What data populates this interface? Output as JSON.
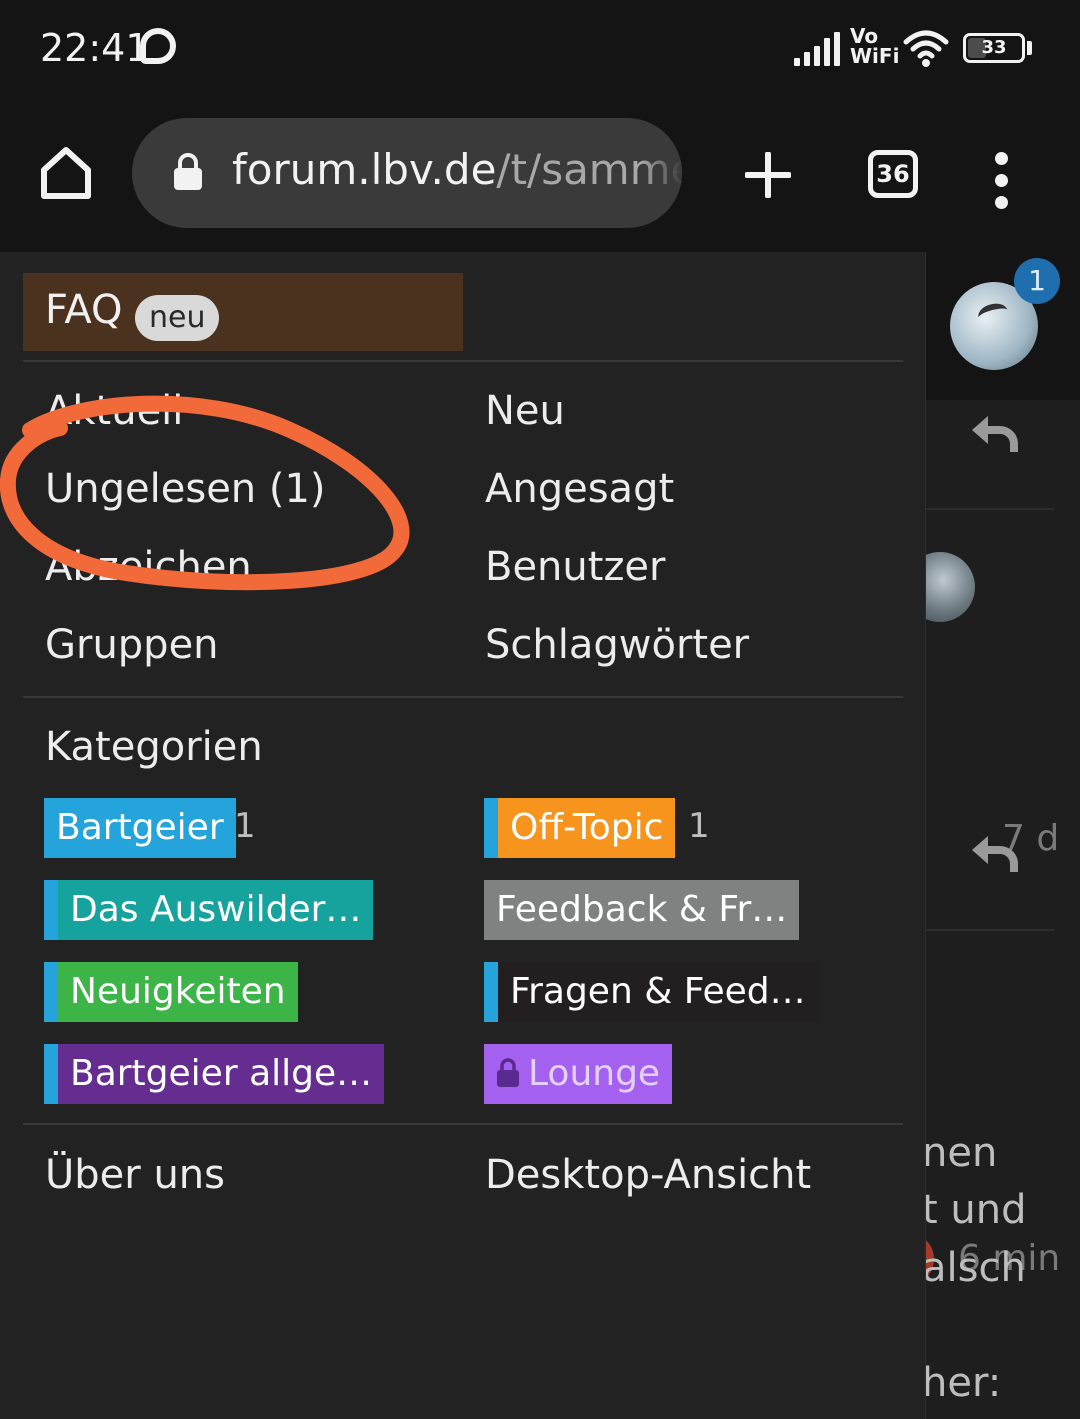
{
  "status_bar": {
    "time": "22:41",
    "network_label_line1": "Vo",
    "network_label_line2": "WiFi",
    "battery": "33"
  },
  "browser": {
    "url_domain": "forum.lbv.de",
    "url_path": "/t/samme",
    "tab_count": "36"
  },
  "menu": {
    "faq_label": "FAQ",
    "faq_badge": "neu",
    "links_left": [
      "Aktuell",
      "Ungelesen (1)",
      "Abzeichen",
      "Gruppen"
    ],
    "links_right": [
      "Neu",
      "Angesagt",
      "Benutzer",
      "Schlagwörter"
    ],
    "categories_title": "Kategorien",
    "categories_left": [
      {
        "label": "Bartgeier",
        "count": "1",
        "color": "#25a4dc",
        "stripe": "#25a4dc"
      },
      {
        "label": "Das Auswilder…",
        "count": "",
        "color": "#16a39e",
        "stripe": "#25a4dc"
      },
      {
        "label": "Neuigkeiten",
        "count": "",
        "color": "#3cb448",
        "stripe": "#25a4dc"
      },
      {
        "label": "Bartgeier allge…",
        "count": "",
        "color": "#652d90",
        "stripe": "#25a4dc"
      }
    ],
    "categories_right": [
      {
        "label": "Off-Topic",
        "count": "1",
        "color": "#f7941d",
        "stripe": "#25a4dc"
      },
      {
        "label": "Feedback & Fr…",
        "count": "",
        "color": "#808281",
        "stripe": ""
      },
      {
        "label": "Fragen & Feed…",
        "count": "",
        "color": "#231f20",
        "stripe": "#25a4dc"
      },
      {
        "label": "Lounge",
        "count": "",
        "color": "#a461ef",
        "stripe": ""
      }
    ],
    "footer_left": "Über uns",
    "footer_right": "Desktop-Ansicht"
  },
  "background_page": {
    "notification_count": "1",
    "post_time_1": "7 d",
    "post_time_2": "6 min",
    "text_fragments": [
      "nen",
      "t und",
      "alsch",
      "her:"
    ]
  },
  "colors": {
    "annotation_circle": "#f26a3a",
    "faq_background": "#4b321e"
  }
}
